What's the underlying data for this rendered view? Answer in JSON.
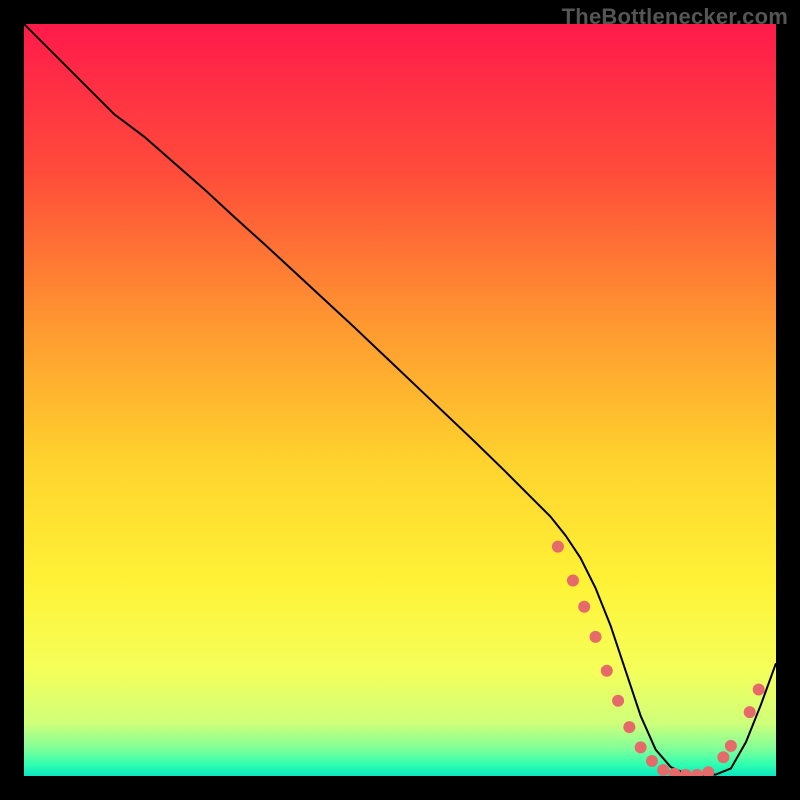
{
  "watermark": "TheBottlenecker.com",
  "chart_data": {
    "type": "line",
    "title": "",
    "xlabel": "",
    "ylabel": "",
    "xlim": [
      0,
      100
    ],
    "ylim": [
      0,
      100
    ],
    "background_gradient": {
      "stops": [
        {
          "offset": 0.0,
          "color": "#ff1a4b"
        },
        {
          "offset": 0.2,
          "color": "#ff4d3a"
        },
        {
          "offset": 0.4,
          "color": "#ff9830"
        },
        {
          "offset": 0.58,
          "color": "#ffd22e"
        },
        {
          "offset": 0.74,
          "color": "#fff236"
        },
        {
          "offset": 0.86,
          "color": "#f5ff5a"
        },
        {
          "offset": 0.93,
          "color": "#cfff7a"
        },
        {
          "offset": 0.965,
          "color": "#7cff9a"
        },
        {
          "offset": 0.985,
          "color": "#2effb0"
        },
        {
          "offset": 1.0,
          "color": "#0ae6c0"
        }
      ]
    },
    "series": [
      {
        "name": "bottleneck-curve",
        "color": "#000000",
        "stroke_width": 2,
        "x": [
          0,
          4,
          8,
          12,
          16,
          20,
          24,
          28,
          32,
          36,
          40,
          44,
          48,
          52,
          56,
          60,
          64,
          68,
          70,
          72,
          74,
          76,
          78,
          80,
          82,
          84,
          86,
          88,
          90,
          92,
          94,
          96,
          98,
          100
        ],
        "y": [
          100,
          96,
          92,
          88,
          85,
          81.5,
          78,
          74.3,
          70.7,
          67,
          63.3,
          59.6,
          55.8,
          52,
          48.2,
          44.4,
          40.5,
          36.5,
          34.5,
          32,
          29,
          25,
          20,
          14,
          8,
          3.5,
          1.2,
          0.3,
          0.1,
          0.2,
          1.0,
          4.5,
          9.5,
          15
        ]
      }
    ],
    "markers": {
      "name": "highlight-points",
      "color": "#e66a6a",
      "radius": 6,
      "points": [
        {
          "x": 71,
          "y": 30.5
        },
        {
          "x": 73,
          "y": 26.0
        },
        {
          "x": 74.5,
          "y": 22.5
        },
        {
          "x": 76,
          "y": 18.5
        },
        {
          "x": 77.5,
          "y": 14.0
        },
        {
          "x": 79,
          "y": 10.0
        },
        {
          "x": 80.5,
          "y": 6.5
        },
        {
          "x": 82,
          "y": 3.8
        },
        {
          "x": 83.5,
          "y": 2.0
        },
        {
          "x": 85,
          "y": 0.8
        },
        {
          "x": 86.5,
          "y": 0.3
        },
        {
          "x": 88,
          "y": 0.15
        },
        {
          "x": 89.5,
          "y": 0.15
        },
        {
          "x": 91,
          "y": 0.5
        },
        {
          "x": 93,
          "y": 2.5
        },
        {
          "x": 94,
          "y": 4.0
        },
        {
          "x": 96.5,
          "y": 8.5
        },
        {
          "x": 97.7,
          "y": 11.5
        }
      ]
    }
  }
}
